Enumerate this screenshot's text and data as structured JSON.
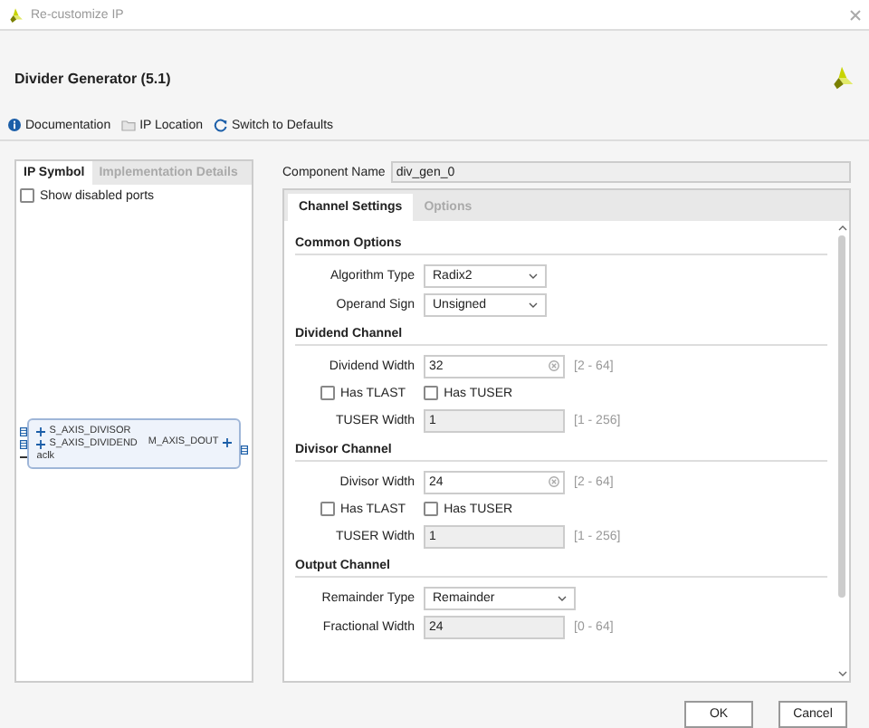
{
  "window": {
    "title": "Re-customize IP"
  },
  "header": {
    "title": "Divider Generator (5.1)"
  },
  "toolbar": [
    {
      "kind": "info",
      "label": "Documentation"
    },
    {
      "kind": "folder",
      "label": "IP Location"
    },
    {
      "kind": "refresh",
      "label": "Switch to Defaults"
    }
  ],
  "left_panel": {
    "tabs": [
      {
        "label": "IP Symbol",
        "selected": true
      },
      {
        "label": "Implementation Details",
        "selected": false
      }
    ],
    "show_disabled_ports": {
      "label": "Show disabled ports",
      "checked": false
    },
    "symbol": {
      "left_ports": [
        {
          "name": "S_AXIS_DIVISOR",
          "kind": "bus"
        },
        {
          "name": "S_AXIS_DIVIDEND",
          "kind": "bus"
        },
        {
          "name": "aclk",
          "kind": "wire"
        }
      ],
      "right_ports": [
        {
          "name": "M_AXIS_DOUT",
          "kind": "bus"
        }
      ]
    }
  },
  "component_name": {
    "label": "Component Name",
    "value": "div_gen_0"
  },
  "tabs": [
    {
      "label": "Channel Settings",
      "selected": true
    },
    {
      "label": "Options",
      "selected": false
    }
  ],
  "sections": [
    {
      "title": "Common Options",
      "rows": [
        {
          "kind": "dropdown",
          "label": "Algorithm Type",
          "value": "Radix2"
        },
        {
          "kind": "dropdown",
          "label": "Operand Sign",
          "value": "Unsigned"
        }
      ]
    },
    {
      "title": "Dividend Channel",
      "rows": [
        {
          "kind": "field",
          "label": "Dividend Width",
          "value": "32",
          "disabled": false,
          "range": "[2 - 64]"
        },
        {
          "kind": "checkboxes",
          "items": [
            {
              "label": "Has TLAST",
              "checked": false
            },
            {
              "label": "Has TUSER",
              "checked": false
            }
          ]
        },
        {
          "kind": "field",
          "label": "TUSER Width",
          "value": "1",
          "disabled": true,
          "range": "[1 - 256]"
        }
      ]
    },
    {
      "title": "Divisor Channel",
      "rows": [
        {
          "kind": "field",
          "label": "Divisor Width",
          "value": "24",
          "disabled": false,
          "range": "[2 - 64]"
        },
        {
          "kind": "checkboxes",
          "items": [
            {
              "label": "Has TLAST",
              "checked": false
            },
            {
              "label": "Has TUSER",
              "checked": false
            }
          ]
        },
        {
          "kind": "field",
          "label": "TUSER Width",
          "value": "1",
          "disabled": true,
          "range": "[1 - 256]"
        }
      ]
    },
    {
      "title": "Output Channel",
      "rows": [
        {
          "kind": "dropdown",
          "label": "Remainder Type",
          "value": "Remainder",
          "wide": true
        },
        {
          "kind": "field",
          "label": "Fractional Width",
          "value": "24",
          "disabled": true,
          "range": "[0 - 64]"
        }
      ]
    }
  ],
  "buttons": [
    {
      "label": "OK"
    },
    {
      "label": "Cancel"
    }
  ]
}
